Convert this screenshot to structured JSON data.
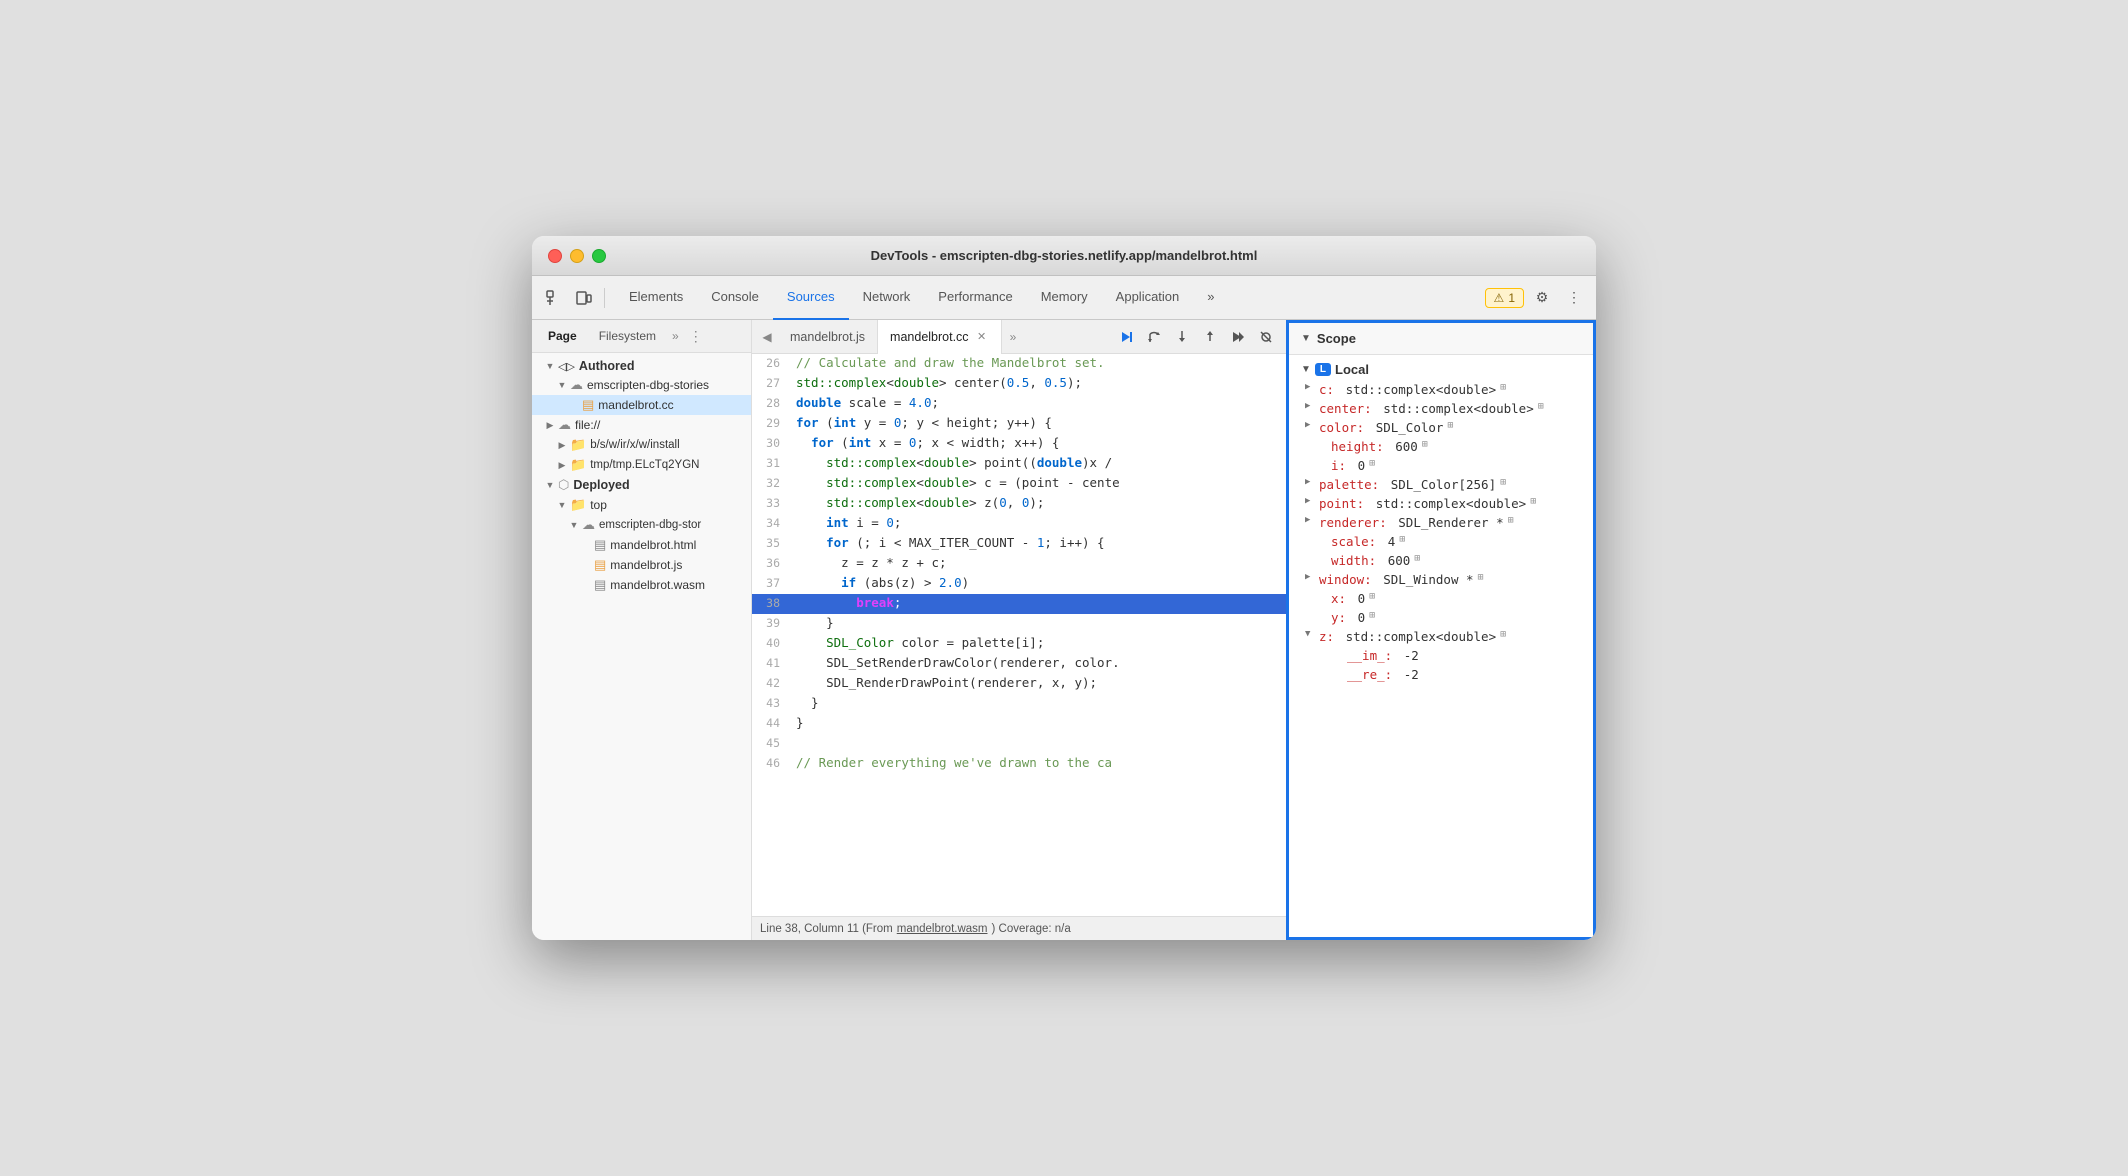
{
  "window": {
    "title": "DevTools - emscripten-dbg-stories.netlify.app/mandelbrot.html"
  },
  "toolbar": {
    "tabs": [
      {
        "label": "Elements",
        "active": false
      },
      {
        "label": "Console",
        "active": false
      },
      {
        "label": "Sources",
        "active": true
      },
      {
        "label": "Network",
        "active": false
      },
      {
        "label": "Performance",
        "active": false
      },
      {
        "label": "Memory",
        "active": false
      },
      {
        "label": "Application",
        "active": false
      },
      {
        "label": "»",
        "active": false
      }
    ],
    "warning_count": "1"
  },
  "sidebar": {
    "tabs": [
      {
        "label": "Page",
        "active": true
      },
      {
        "label": "Filesystem",
        "active": false
      }
    ],
    "tree": {
      "authored_label": "◂ ▸ Authored",
      "cloud_label": "emscripten-dbg-stories",
      "file_cc": "mandelbrot.cc",
      "file_label": "▸ ☁ file://",
      "folder_b": "▸  b/s/w/ir/x/w/install",
      "folder_t": "▸  tmp/tmp.ELcTq2YGN",
      "deployed_label": "▸  Deployed",
      "top_label": "▸  top",
      "deployed_cloud": "▸ ☁ emscripten-dbg-stor",
      "file_html": "mandelbrot.html",
      "file_js": "mandelbrot.js",
      "file_wasm": "mandelbrot.wasm"
    }
  },
  "code_panel": {
    "tabs": [
      {
        "label": "mandelbrot.js",
        "active": false,
        "closeable": false
      },
      {
        "label": "mandelbrot.cc",
        "active": true,
        "closeable": true
      }
    ],
    "lines": [
      {
        "num": "29",
        "content": ""
      },
      {
        "num": "26",
        "text": "// Calculate and draw the Mandelbrot set."
      },
      {
        "num": "27",
        "text": "std::complex<double> center(0.5, 0.5);"
      },
      {
        "num": "28",
        "text": "double scale = 4.0;"
      },
      {
        "num": "29",
        "text": "for (int y = 0; y < height; y++) {"
      },
      {
        "num": "30",
        "text": "  for (int x = 0; x < width; x++) {"
      },
      {
        "num": "31",
        "text": "    std::complex<double> point((double)x /"
      },
      {
        "num": "32",
        "text": "    std::complex<double> c = (point - cente"
      },
      {
        "num": "33",
        "text": "    std::complex<double> z(0, 0);"
      },
      {
        "num": "34",
        "text": "    int i = 0;"
      },
      {
        "num": "35",
        "text": "    for (; i < MAX_ITER_COUNT - 1; i++) {"
      },
      {
        "num": "36",
        "text": "      z = z * z + c;"
      },
      {
        "num": "37",
        "text": "      if (abs(z) > 2.0)"
      },
      {
        "num": "38",
        "text": "        break;",
        "highlighted": true
      },
      {
        "num": "39",
        "text": "    }"
      },
      {
        "num": "40",
        "text": "    SDL_Color color = palette[i];"
      },
      {
        "num": "41",
        "text": "    SDL_SetRenderDrawColor(renderer, color."
      },
      {
        "num": "42",
        "text": "    SDL_RenderDrawPoint(renderer, x, y);"
      },
      {
        "num": "43",
        "text": "  }"
      },
      {
        "num": "44",
        "text": "}"
      },
      {
        "num": "45",
        "text": ""
      },
      {
        "num": "46",
        "text": "// Render everything we've drawn to the ca"
      }
    ],
    "status": {
      "text": "Line 38, Column 11 (From ",
      "link": "mandelbrot.wasm",
      "text2": ") Coverage: n/a"
    }
  },
  "scope": {
    "title": "Scope",
    "section": "Local",
    "items": [
      {
        "key": "c:",
        "val": "std::complex<double>",
        "expandable": true,
        "grid": true
      },
      {
        "key": "center:",
        "val": "std::complex<double>",
        "expandable": true,
        "grid": true
      },
      {
        "key": "color:",
        "val": "SDL_Color",
        "expandable": true,
        "grid": true
      },
      {
        "key": "height:",
        "val": "600",
        "expandable": false,
        "grid": true
      },
      {
        "key": "i:",
        "val": "0",
        "expandable": false,
        "grid": true
      },
      {
        "key": "palette:",
        "val": "SDL_Color[256]",
        "expandable": true,
        "grid": true
      },
      {
        "key": "point:",
        "val": "std::complex<double>",
        "expandable": true,
        "grid": true
      },
      {
        "key": "renderer:",
        "val": "SDL_Renderer *",
        "expandable": true,
        "grid": true
      },
      {
        "key": "scale:",
        "val": "4",
        "expandable": false,
        "grid": true
      },
      {
        "key": "width:",
        "val": "600",
        "expandable": false,
        "grid": true
      },
      {
        "key": "window:",
        "val": "SDL_Window *",
        "expandable": true,
        "grid": true
      },
      {
        "key": "x:",
        "val": "0",
        "expandable": false,
        "grid": true
      },
      {
        "key": "y:",
        "val": "0",
        "expandable": false,
        "grid": true
      },
      {
        "key": "z:",
        "val": "std::complex<double>",
        "expandable": true,
        "grid": true
      },
      {
        "key": "__im_:",
        "val": "-2",
        "expandable": false,
        "grid": false,
        "indent": true
      },
      {
        "key": "__re_:",
        "val": "-2",
        "expandable": false,
        "grid": false,
        "indent": true
      }
    ]
  }
}
